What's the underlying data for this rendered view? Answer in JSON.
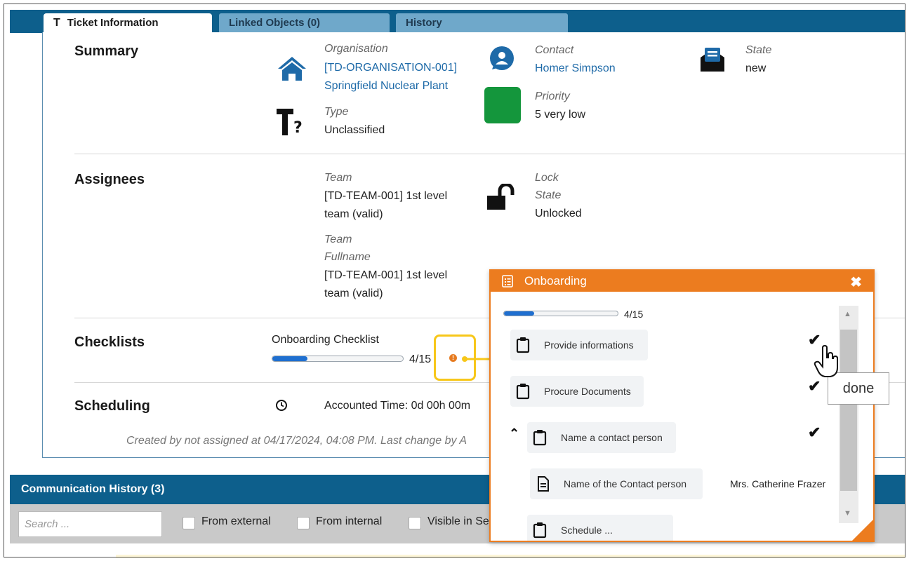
{
  "tabs": [
    {
      "label": "Ticket Information",
      "active": true
    },
    {
      "label": "Linked Objects (0)",
      "active": false
    },
    {
      "label": "History",
      "active": false
    }
  ],
  "summary": {
    "title": "Summary",
    "organisation_label": "Organisation",
    "organisation_id": "[TD-ORGANISATION-001]",
    "organisation_name": "Springfield Nuclear Plant",
    "type_label": "Type",
    "type_value": "Unclassified",
    "contact_label": "Contact",
    "contact_value": "Homer Simpson",
    "priority_label": "Priority",
    "priority_value": "5 very low",
    "priority_color": "#14963c",
    "state_label": "State",
    "state_value": "new"
  },
  "assignees": {
    "title": "Assignees",
    "team_label": "Team",
    "team_value": "[TD-TEAM-001] 1st level team (valid)",
    "team_fullname_label_1": "Team",
    "team_fullname_label_2": "Fullname",
    "team_fullname_value": "[TD-TEAM-001] 1st level team (valid)",
    "lock_label_1": "Lock",
    "lock_label_2": "State",
    "lock_value": "Unlocked"
  },
  "checklists": {
    "title": "Checklists",
    "name": "Onboarding Checklist",
    "progress_text": "4/15",
    "progress_fraction": 0.267
  },
  "scheduling": {
    "title": "Scheduling",
    "accounted_time": "Accounted Time: 0d 00h 00m"
  },
  "footer_note": "Created by not assigned at 04/17/2024, 04:08 PM. Last change by A",
  "communication": {
    "title": "Communication History (3)",
    "search_placeholder": "Search ...",
    "filters": [
      "From external",
      "From internal",
      "Visible in Se"
    ]
  },
  "popup": {
    "title": "Onboarding",
    "close_glyph": "✖",
    "progress_text": "4/15",
    "progress_fraction": 0.267,
    "items": [
      {
        "label": "Provide informations",
        "done": true
      },
      {
        "label": "Procure Documents",
        "done": true
      },
      {
        "label": "Name a contact person",
        "done": true,
        "expanded": true
      },
      {
        "label": "Name of the Contact person",
        "value": "Mrs. Catherine Frazer"
      }
    ],
    "partial_item": "Schedule ...",
    "tooltip": "done"
  },
  "colors": {
    "header_blue": "#0d5f8c",
    "popup_orange": "#ec7c1f",
    "link_blue": "#1e6aa8",
    "highlight_yellow": "#f7c71a"
  }
}
